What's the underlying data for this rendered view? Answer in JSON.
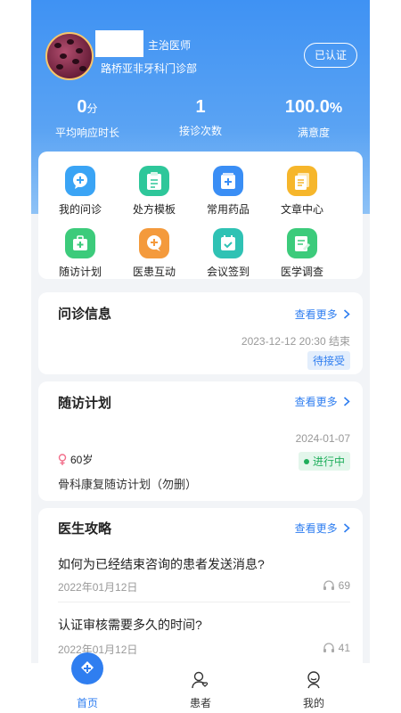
{
  "doctor": {
    "title": "主治医师",
    "hospital": "路桥亚非牙科门诊部",
    "verify_label": "已认证"
  },
  "stats": [
    {
      "value": "0",
      "unit": "分",
      "label": "平均响应时长"
    },
    {
      "value": "1",
      "unit": "",
      "label": "接诊次数"
    },
    {
      "value": "100.0",
      "unit": "%",
      "label": "满意度"
    }
  ],
  "grid": [
    {
      "label": "我的问诊",
      "icon": "chat-bubble-icon",
      "color": "#3aa4f5"
    },
    {
      "label": "处方模板",
      "icon": "clipboard-icon",
      "color": "#2ec79a"
    },
    {
      "label": "常用药品",
      "icon": "medicine-box-icon",
      "color": "#3a8ef5"
    },
    {
      "label": "文章中心",
      "icon": "document-stack-icon",
      "color": "#f6b62b"
    },
    {
      "label": "随访计划",
      "icon": "medical-bag-icon",
      "color": "#3ccb7b"
    },
    {
      "label": "医患互动",
      "icon": "chat-plus-icon",
      "color": "#f49a3c"
    },
    {
      "label": "会议签到",
      "icon": "calendar-check-icon",
      "color": "#2fc2b4"
    },
    {
      "label": "医学调查",
      "icon": "survey-edit-icon",
      "color": "#3ccb7b"
    }
  ],
  "consult": {
    "title": "问诊信息",
    "more": "查看更多",
    "time": "2023-12-12 20:30 结束",
    "status": "待接受",
    "status_color": "#2f7ef0"
  },
  "followup": {
    "title": "随访计划",
    "more": "查看更多",
    "date": "2024-01-07",
    "age": "60岁",
    "status": "进行中",
    "plan": "骨科康复随访计划（勿删）",
    "status_color": "#1fae5b"
  },
  "guide": {
    "title": "医生攻略",
    "more": "查看更多",
    "articles": [
      {
        "title": "如何为已经结束咨询的患者发送消息?",
        "date": "2022年01月12日",
        "plays": "69"
      },
      {
        "title": "认证审核需要多久的时间?",
        "date": "2022年01月12日",
        "plays": "41"
      }
    ]
  },
  "nav": [
    {
      "label": "首页",
      "icon": "home-cross-icon",
      "active": true
    },
    {
      "label": "患者",
      "icon": "patient-icon",
      "active": false
    },
    {
      "label": "我的",
      "icon": "profile-icon",
      "active": false
    }
  ],
  "accent": "#2f7ef0"
}
